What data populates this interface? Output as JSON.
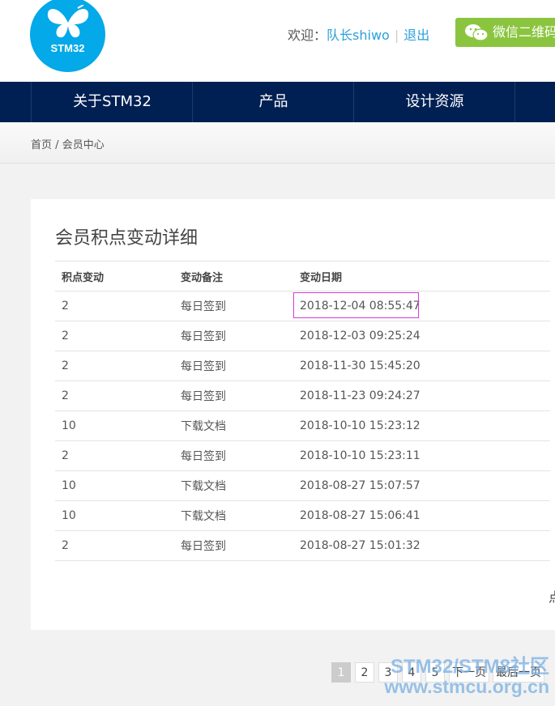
{
  "header": {
    "logo_text": "STM32",
    "welcome": "欢迎：",
    "username": "队长shiwo",
    "separator": "|",
    "logout": "退出",
    "wechat_label": "微信二维码",
    "wechat_icon": "wechat-icon"
  },
  "nav": {
    "items": [
      "关于STM32",
      "产品",
      "设计资源"
    ]
  },
  "breadcrumb": {
    "home": "首页",
    "separator": "/",
    "current": "会员中心"
  },
  "main": {
    "title": "会员积点变动详细",
    "columns": [
      "积点变动",
      "变动备注",
      "变动日期"
    ],
    "rows": [
      {
        "points": "2",
        "note": "每日签到",
        "date": "2018-12-04 08:55:47"
      },
      {
        "points": "2",
        "note": "每日签到",
        "date": "2018-12-03 09:25:24"
      },
      {
        "points": "2",
        "note": "每日签到",
        "date": "2018-11-30 15:45:20"
      },
      {
        "points": "2",
        "note": "每日签到",
        "date": "2018-11-23 09:24:27"
      },
      {
        "points": "10",
        "note": "下载文档",
        "date": "2018-10-10 15:23:12"
      },
      {
        "points": "2",
        "note": "每日签到",
        "date": "2018-10-10 15:23:11"
      },
      {
        "points": "10",
        "note": "下载文档",
        "date": "2018-08-27 15:07:57"
      },
      {
        "points": "10",
        "note": "下载文档",
        "date": "2018-08-27 15:06:41"
      },
      {
        "points": "2",
        "note": "每日签到",
        "date": "2018-08-27 15:01:32"
      }
    ],
    "cut_off_char": "点"
  },
  "pagination": {
    "pages": [
      "1",
      "2",
      "3",
      "4",
      "5"
    ],
    "current": "1",
    "next": "下一页",
    "last": "最后一页"
  },
  "watermark": {
    "line1": "STM32/STM8社区",
    "line2": "www.stmcu.org.cn"
  },
  "colors": {
    "nav_bg": "#002053",
    "logo": "#03a9e8",
    "wechat": "#8bc53f",
    "link": "#2aa0dc",
    "highlight": "#d93ad9"
  }
}
